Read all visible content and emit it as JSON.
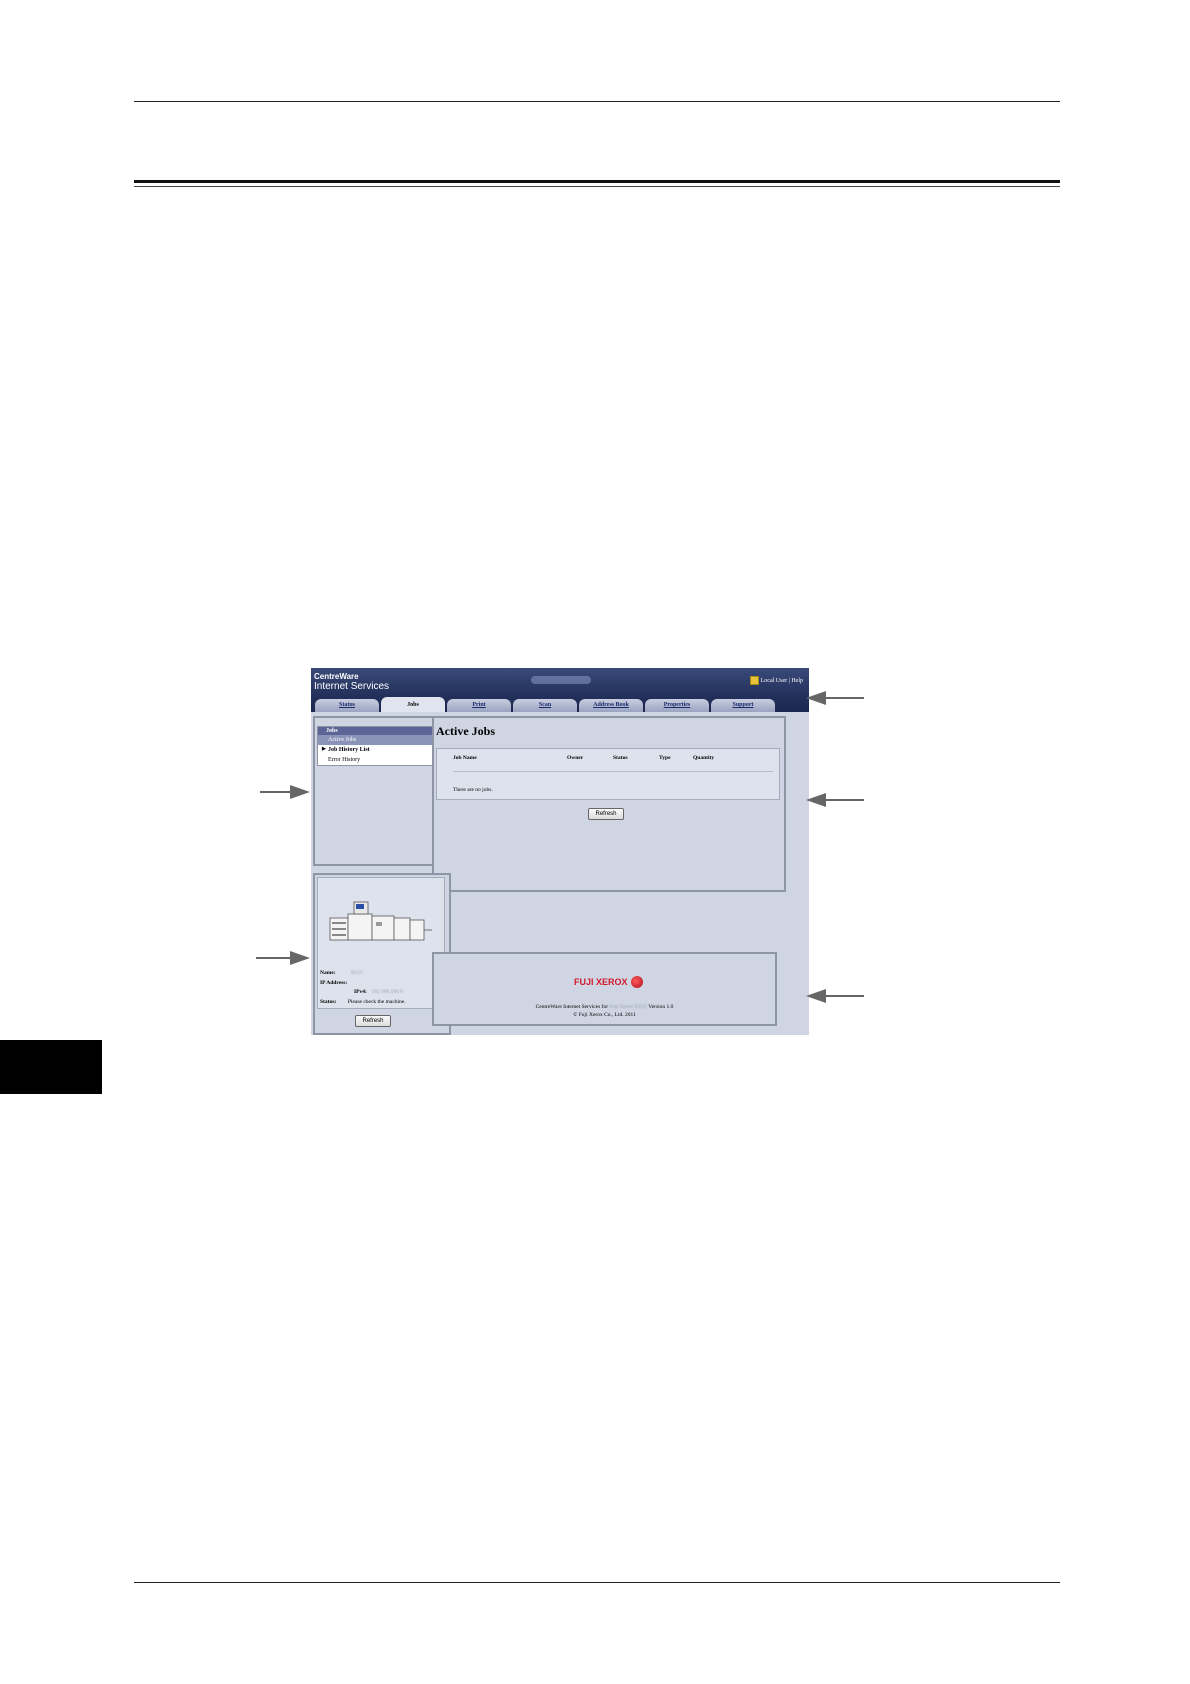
{
  "app": {
    "brand_line1": "CentreWare",
    "brand_line2": "Internet Services",
    "top_right": "Local User | Help"
  },
  "tabs": [
    {
      "label": "Status"
    },
    {
      "label": "Jobs"
    },
    {
      "label": "Print"
    },
    {
      "label": "Scan"
    },
    {
      "label": "Address Book"
    },
    {
      "label": "Properties"
    },
    {
      "label": "Support"
    }
  ],
  "menu": {
    "heading": "Jobs",
    "items": [
      "Active Jobs",
      "Job History List",
      "Error History"
    ]
  },
  "main": {
    "title": "Active Jobs",
    "columns": [
      "Job Name",
      "Owner",
      "Status",
      "Type",
      "Quantity"
    ],
    "empty_text": "There are no jobs.",
    "refresh": "Refresh"
  },
  "device": {
    "name_label": "Name:",
    "name_value": "D125",
    "ip_label": "IP Address:",
    "ipv4_label": "IPv4:",
    "ipv4_value": "192.168.100.8",
    "status_label": "Status:",
    "status_value": "Please check the machine.",
    "refresh": "Refresh"
  },
  "footer": {
    "logo_text": "FUJI XEROX",
    "line1_a": "CentreWare Internet Services for",
    "line1_b": "Fuji Xerox D125",
    "line1_c": "Version 1.0",
    "line2": "© Fuji Xerox Co., Ltd. 2011"
  },
  "colors": {
    "header_bg": "#24315c",
    "panel_bg": "#cfd5e3",
    "logo_red": "#d01a2c"
  }
}
